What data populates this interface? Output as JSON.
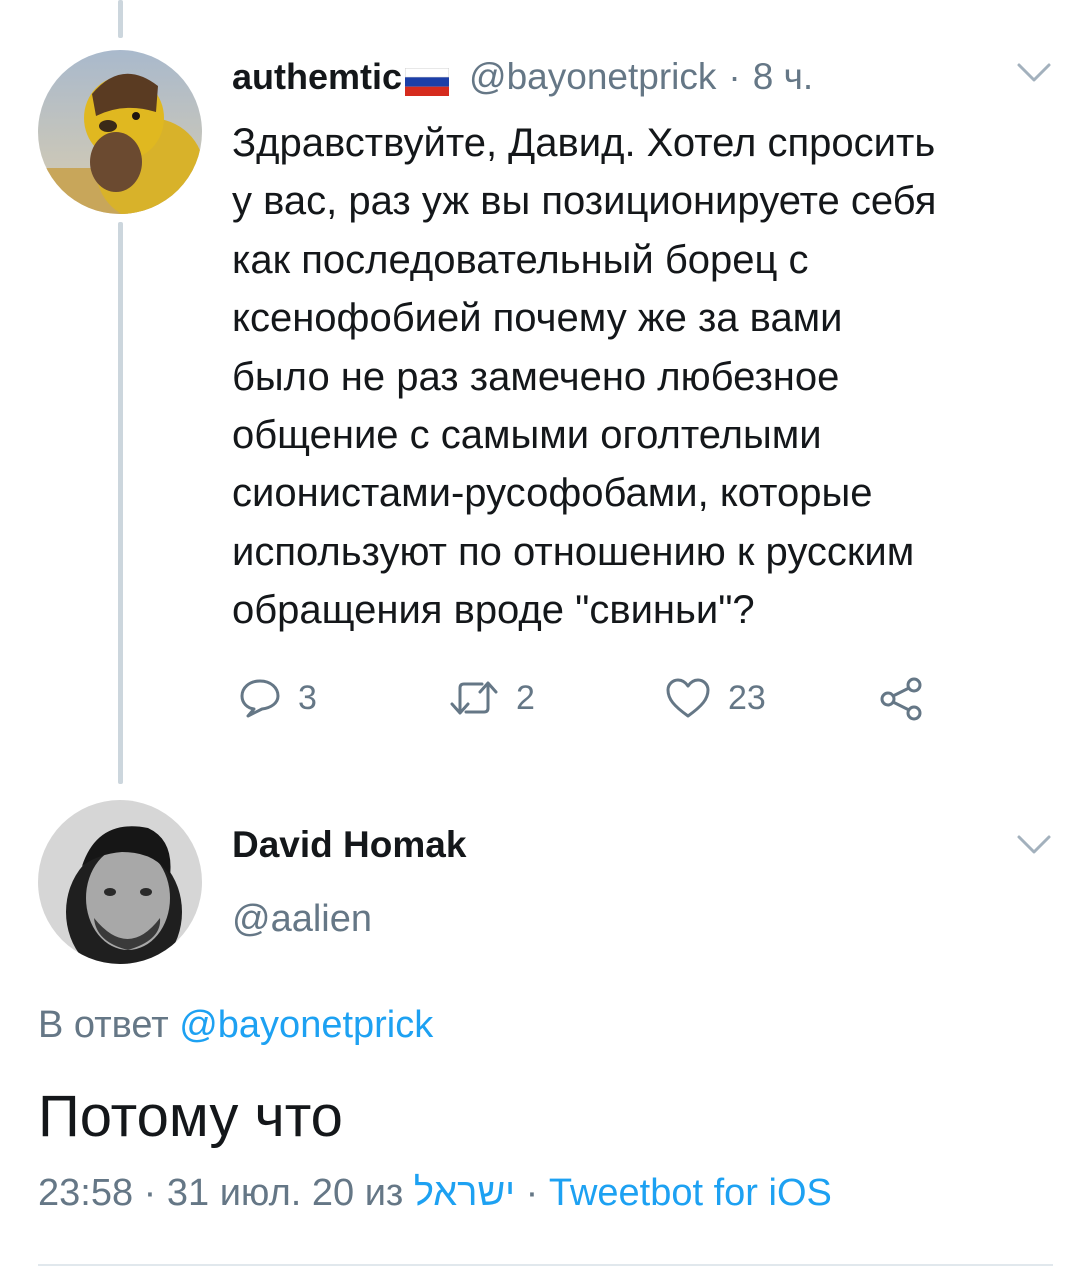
{
  "reply_tweet": {
    "display_name": "authemtic",
    "flag_icon": "russia-flag-icon",
    "handle": "@bayonetprick",
    "separator": "·",
    "time_ago": "8 ч.",
    "text_lines": [
      "Здравствуйте, Давид. Хотел спросить",
      "у вас, раз уж вы позиционируете себя",
      "как последовательный борец с",
      "ксенофобией почему же за вами",
      "было не раз замечено любезное",
      "общение с самыми оголтелыми",
      "сионистами-русофобами, которые",
      "используют по отношению к русским",
      "обращения вроде \"свиньи\"?"
    ],
    "replies_count": "3",
    "retweets_count": "2",
    "likes_count": "23",
    "icons": {
      "reply": "speech-bubble-icon",
      "retweet": "retweet-icon",
      "like": "heart-icon",
      "share": "share-icon",
      "menu": "chevron-down-icon"
    }
  },
  "main_tweet": {
    "display_name": "David Homak",
    "handle": "@aalien",
    "reply_to_label": "В ответ",
    "reply_to_handle": "@bayonetprick",
    "text": "Потому что",
    "timestamp": "23:58 · 31 июл. 20 из",
    "location": "ישראל",
    "separator": "·",
    "client": "Tweetbot for iOS"
  },
  "colors": {
    "link": "#1da1f2",
    "muted": "#657786",
    "text": "#14171a",
    "thread_line": "#ccd6dd"
  }
}
